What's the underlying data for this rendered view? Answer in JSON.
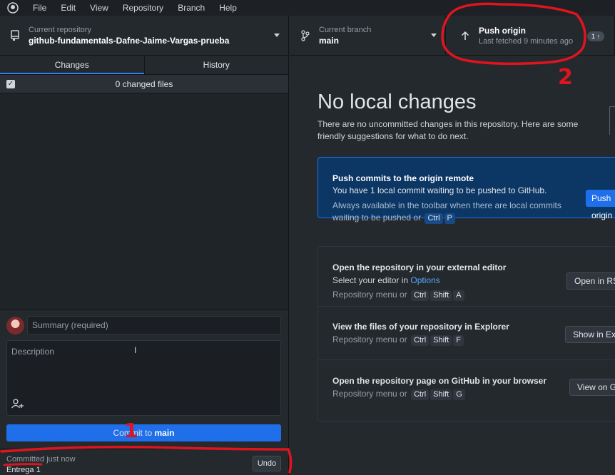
{
  "menubar": {
    "items": [
      "File",
      "Edit",
      "View",
      "Repository",
      "Branch",
      "Help"
    ]
  },
  "toolbar": {
    "repo_label": "Current repository",
    "repo_value": "github-fundamentals-Dafne-Jaime-Vargas-prueba",
    "branch_label": "Current branch",
    "branch_value": "main",
    "push_title": "Push origin",
    "push_sub": "Last fetched 9 minutes ago",
    "push_badge": "1 ↑"
  },
  "sidebar": {
    "tabs": [
      "Changes",
      "History"
    ],
    "changed_files": "0 changed files"
  },
  "commit": {
    "summary_placeholder": "Summary (required)",
    "description_placeholder": "Description",
    "button_prefix": "Commit to ",
    "button_branch": "main"
  },
  "last_commit": {
    "title": "Committed just now",
    "message": "Entrega 1",
    "undo_label": "Undo"
  },
  "main": {
    "title": "No local changes",
    "subtitle": "There are no uncommitted changes in this repository. Here are some friendly suggestions for what to do next.",
    "push_card": {
      "title": "Push commits to the origin remote",
      "desc": "You have 1 local commit waiting to be pushed to GitHub.",
      "hint": "Always available in the toolbar when there are local commits waiting to be pushed or",
      "keys": [
        "Ctrl",
        "P"
      ],
      "button": "Push origin"
    },
    "actions": [
      {
        "title": "Open the repository in your external editor",
        "desc_prefix": "Select your editor in ",
        "desc_link": "Options",
        "hint": "Repository menu or",
        "keys": [
          "Ctrl",
          "Shift",
          "A"
        ],
        "button": "Open in RStudio"
      },
      {
        "title": "View the files of your repository in Explorer",
        "hint": "Repository menu or",
        "keys": [
          "Ctrl",
          "Shift",
          "F"
        ],
        "button": "Show in Explorer"
      },
      {
        "title": "Open the repository page on GitHub in your browser",
        "hint": "Repository menu or",
        "keys": [
          "Ctrl",
          "Shift",
          "G"
        ],
        "button": "View on GitHub"
      }
    ]
  },
  "annotations": {
    "label_1": "1",
    "label_2": "2",
    "color": "#e0141e"
  }
}
